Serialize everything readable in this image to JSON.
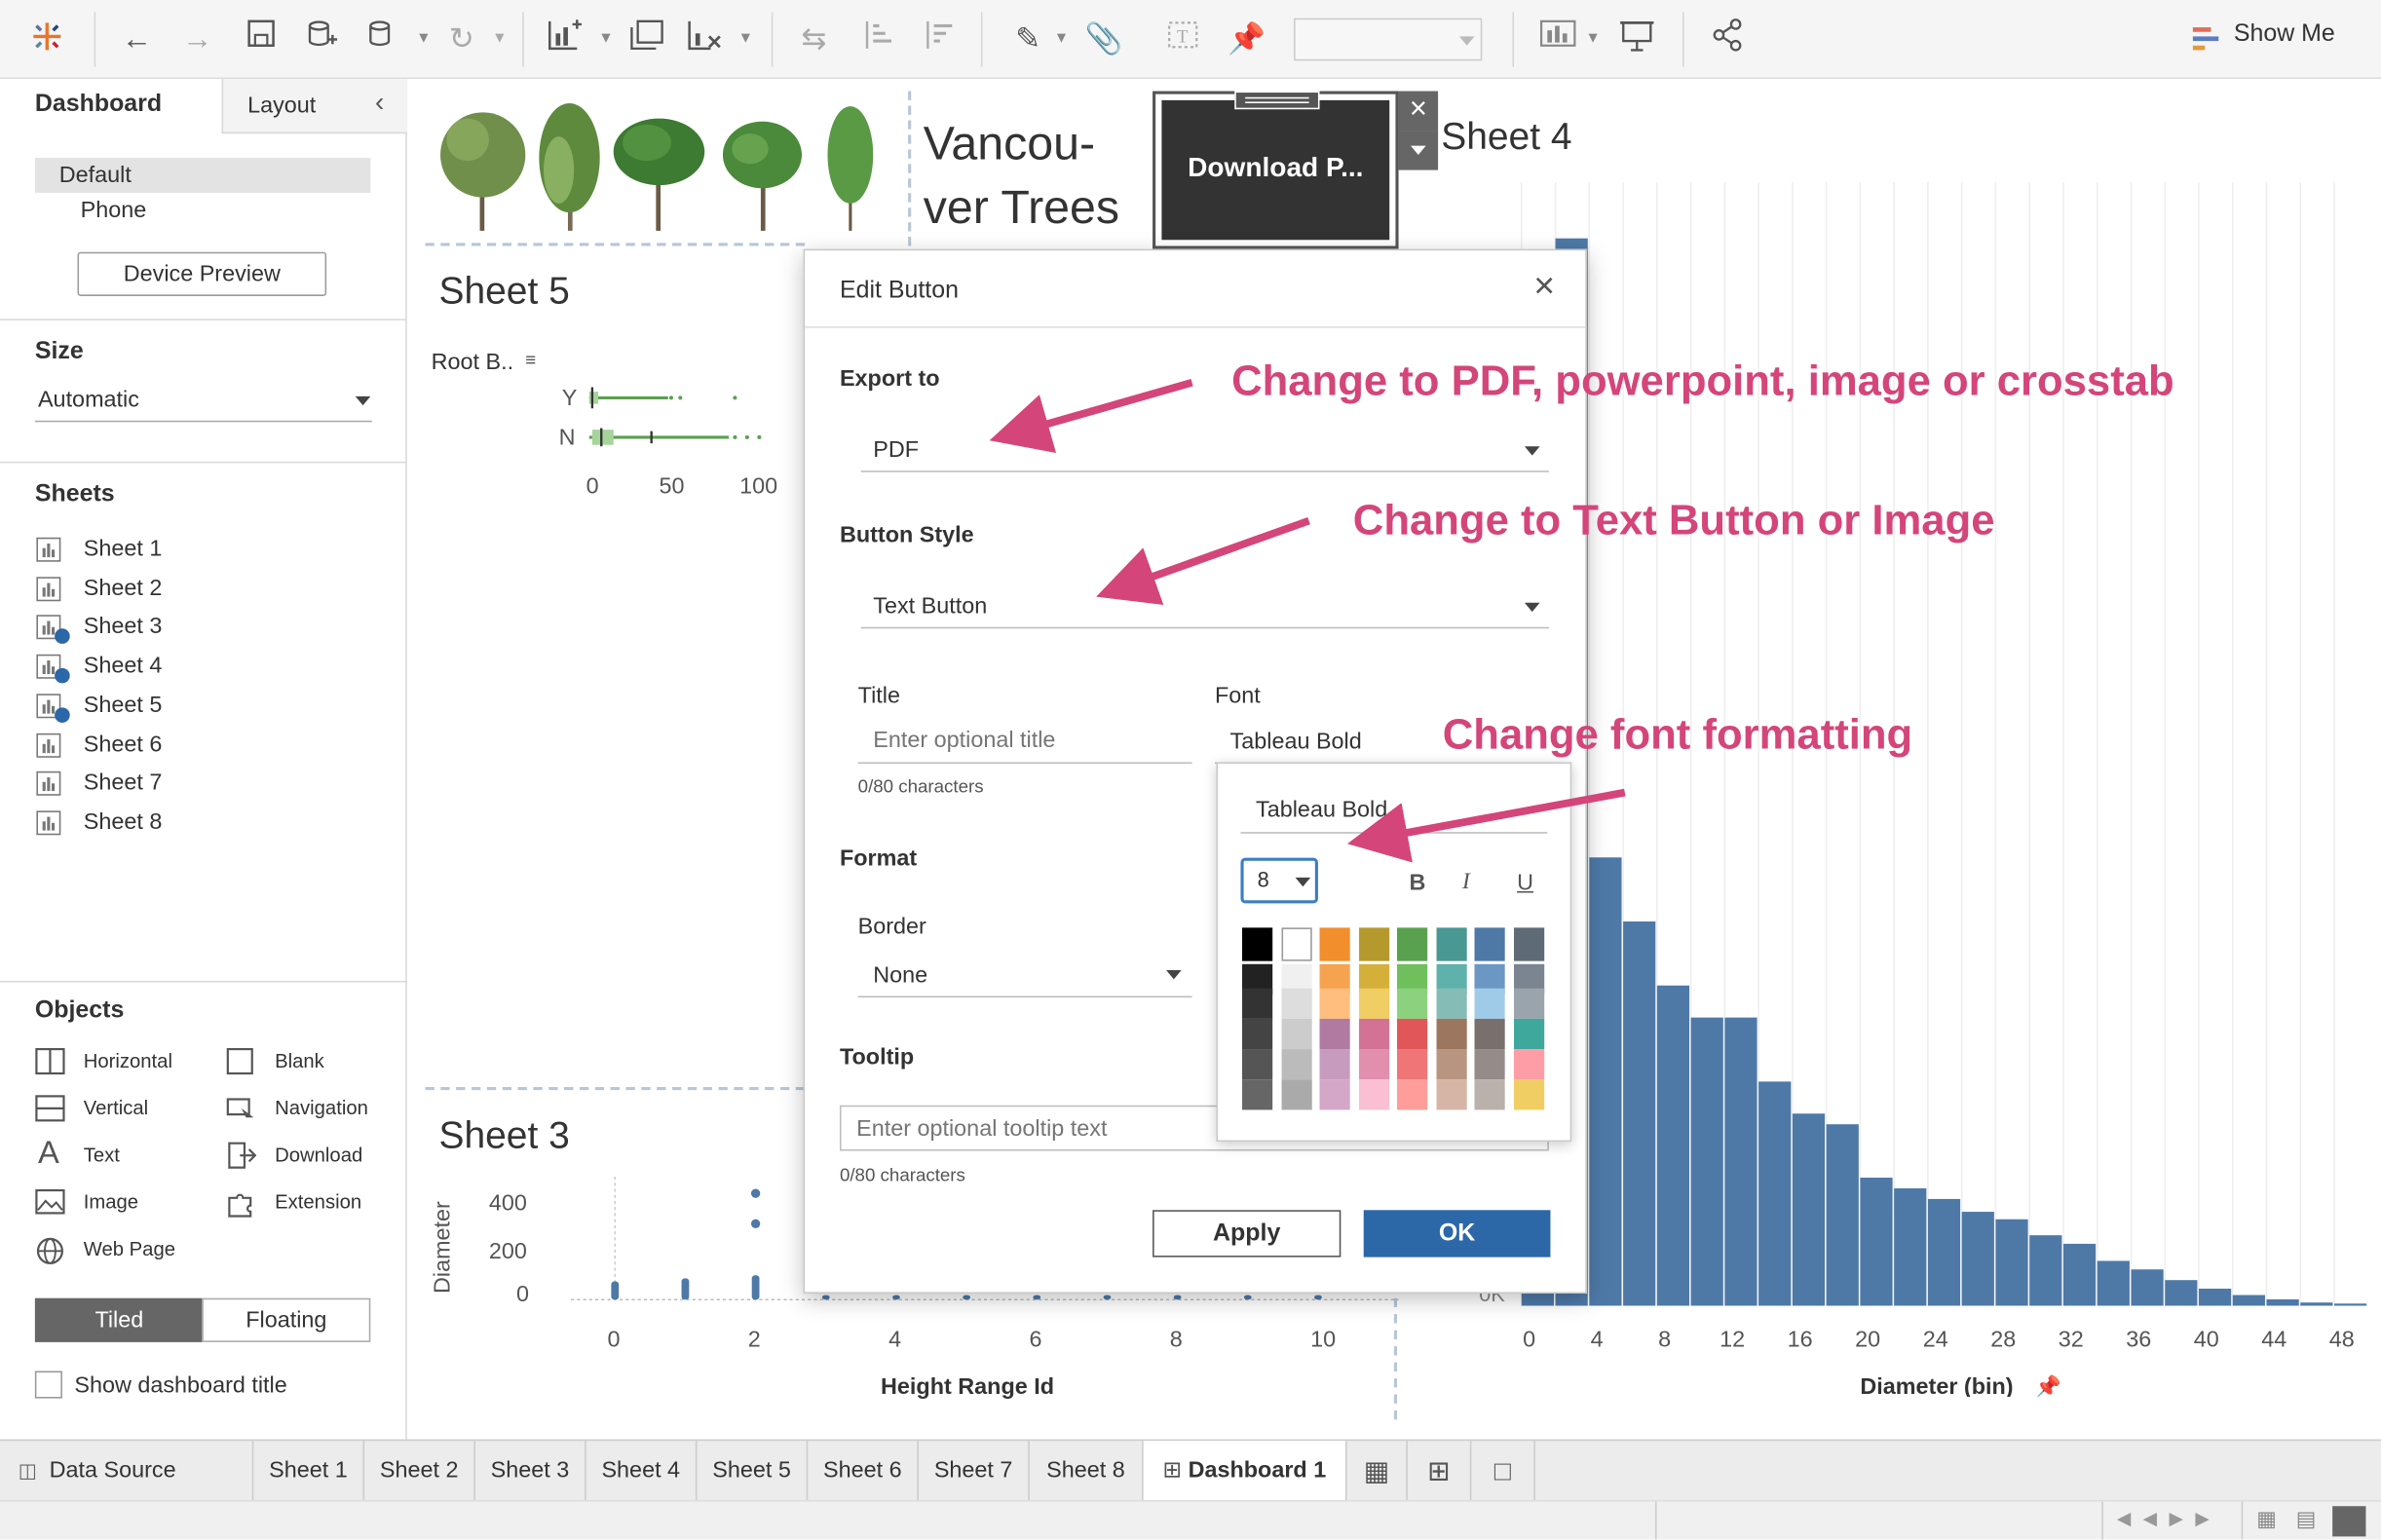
{
  "toolbar": {
    "icons": [
      "tableau-logo-icon",
      "back-icon",
      "forward-icon",
      "save-icon",
      "new-datasource-icon",
      "pause-updates-icon",
      "refresh-icon",
      "new-worksheet-icon",
      "duplicate-sheet-icon",
      "clear-sheet-icon",
      "swap-icon",
      "sort-ascending-icon",
      "sort-descending-icon",
      "highlight-icon",
      "group-icon",
      "label-icon",
      "pin-icon",
      "fit-dropdown",
      "show-cards-icon",
      "presentation-icon",
      "share-icon"
    ],
    "show_me_label": "Show Me"
  },
  "left_panel": {
    "tabs": {
      "dashboard": "Dashboard",
      "layout": "Layout"
    },
    "devices": {
      "default": "Default",
      "phone": "Phone"
    },
    "device_preview_label": "Device Preview",
    "size": {
      "title": "Size",
      "value": "Automatic"
    },
    "sheets": {
      "title": "Sheets",
      "items": [
        "Sheet 1",
        "Sheet 2",
        "Sheet 3",
        "Sheet 4",
        "Sheet 5",
        "Sheet 6",
        "Sheet 7",
        "Sheet 8"
      ]
    },
    "objects": {
      "title": "Objects",
      "items": [
        "Horizontal",
        "Blank",
        "Vertical",
        "Navigation",
        "Text",
        "Download",
        "Image",
        "Extension",
        "Web Page"
      ]
    },
    "tiled_label": "Tiled",
    "floating_label": "Floating",
    "show_title_label": "Show dashboard title"
  },
  "canvas": {
    "header_title": "Vancou-\nver Trees",
    "download_button_label": "Download P...",
    "sheet4_title": "Sheet 4",
    "sheet5": {
      "title": "Sheet 5",
      "field_label": "Root B..",
      "rows": [
        "Y",
        "N"
      ],
      "ticks": [
        "0",
        "50",
        "100"
      ]
    },
    "sheet3": {
      "title": "Sheet 3",
      "ylabel": "Diameter",
      "yticks": [
        "400",
        "200",
        "0"
      ],
      "xticks": [
        "0",
        "2",
        "4",
        "6",
        "8",
        "10"
      ],
      "xlabel": "Height Range Id"
    },
    "sheet4": {
      "xticks": [
        "0",
        "4",
        "8",
        "12",
        "16",
        "20",
        "24",
        "28",
        "32",
        "36",
        "40",
        "44",
        "48"
      ],
      "xlabel": "Diameter (bin)",
      "partial_ytick": "0K"
    }
  },
  "chart_data": {
    "type": "bar",
    "xlabel": "Diameter (bin)",
    "values": [
      0.02,
      1.0,
      0.42,
      0.36,
      0.3,
      0.27,
      0.27,
      0.21,
      0.18,
      0.17,
      0.12,
      0.11,
      0.1,
      0.088,
      0.081,
      0.066,
      0.058,
      0.042,
      0.034,
      0.024,
      0.016,
      0.01,
      0.006,
      0.003,
      0.002
    ]
  },
  "dialog": {
    "title": "Edit Button",
    "export_label": "Export to",
    "export_value": "PDF",
    "style_label": "Button Style",
    "style_value": "Text Button",
    "title_label": "Title",
    "title_placeholder": "Enter optional title",
    "title_count": "0/80 characters",
    "font_label": "Font",
    "font_value": "Tableau Bold",
    "format_label": "Format",
    "border_label": "Border",
    "border_value": "None",
    "tooltip_label": "Tooltip",
    "tooltip_placeholder": "Enter optional tooltip text",
    "tooltip_count": "0/80 characters",
    "apply_label": "Apply",
    "ok_label": "OK",
    "font_popup": {
      "font_value": "Tableau Bold",
      "size_value": "8",
      "bold": "B",
      "italic": "I",
      "underline": "U"
    }
  },
  "palette_colors": [
    [
      "#000000",
      "#222222",
      "#333333",
      "#444444",
      "#555555",
      "#666666"
    ],
    [
      "#ffffff",
      "#f0f0f0",
      "#dddddd",
      "#cccccc",
      "#bbbbbb",
      "#aaaaaa"
    ],
    [
      "#f28e2b",
      "#f6a34f",
      "#ffbe7d",
      "#b07aa1",
      "#c79bbe",
      "#d4a6c8"
    ],
    [
      "#b6992d",
      "#d4b03a",
      "#f1ce63",
      "#d37295",
      "#e28fae",
      "#fabfd2"
    ],
    [
      "#59a14f",
      "#6fbf5c",
      "#8cd17d",
      "#e15759",
      "#f07577",
      "#ff9d9a"
    ],
    [
      "#499894",
      "#5fb1ac",
      "#86bcb6",
      "#9d7660",
      "#b89580",
      "#d7b5a6"
    ],
    [
      "#4e79a7",
      "#6b97c5",
      "#a0cbe8",
      "#79706e",
      "#958c8a",
      "#bab0ac"
    ],
    [
      "#5e6a76",
      "#7a8591",
      "#9aa4ad",
      "#3fa89c",
      "#ff9da7",
      "#f1ce63"
    ]
  ],
  "annotations": {
    "export": "Change to PDF, powerpoint, image or crosstab",
    "style": "Change to Text Button or Image",
    "font": "Change font formatting"
  },
  "bottom_tabs": [
    "Data Source",
    "Sheet 1",
    "Sheet 2",
    "Sheet 3",
    "Sheet 4",
    "Sheet 5",
    "Sheet 6",
    "Sheet 7",
    "Sheet 8",
    "Dashboard 1"
  ]
}
